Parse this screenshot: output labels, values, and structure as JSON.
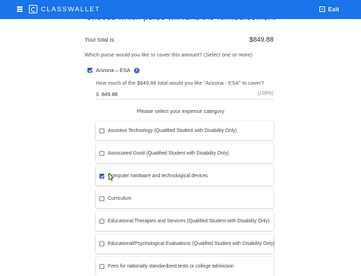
{
  "app": {
    "brand": "CLASSWALLET",
    "exit_label": "Exit"
  },
  "page": {
    "heading": "Choose which purse will fund the reimbursement",
    "total_label": "Your total is:",
    "total_value": "$849.88",
    "purse_question": "Which purse would you like to cover this amount? (Select one or more)"
  },
  "purse": {
    "label": "Arizona – ESA",
    "checked": true,
    "info_icon": "i",
    "amount_question": "How much of the $849.88 total would you like \"Arizona - ESA\" to cover?",
    "currency_symbol": "$",
    "amount_value": "849.88",
    "percent": "(100%)"
  },
  "categories": {
    "heading": "Please select your expense category",
    "items": [
      {
        "label": "Assistive Technology (Qualified Student with Disability Only)",
        "checked": false
      },
      {
        "label": "Associated Good (Qualified Student with Disability Only)",
        "checked": false
      },
      {
        "label": "Computer hardware and technological devices",
        "checked": true
      },
      {
        "label": "Curriculum",
        "checked": false
      },
      {
        "label": "Educational Therapies and Services (Qualified Student with Disability Only)",
        "checked": false
      },
      {
        "label": "Educational/Psychological Evaluations (Qualified Student with Disability Only)",
        "checked": false
      },
      {
        "label": "Fees for nationally standardized tests or college admission",
        "checked": false
      }
    ]
  },
  "colors": {
    "topbar": "#1a73e8",
    "checkbox_checked": "#3c5cc4",
    "info_icon": "#3c6fd8"
  },
  "icons": {
    "menu": "hamburger-menu-icon",
    "logo": "classwallet-logo-icon",
    "exit": "exit-icon",
    "info": "info-icon",
    "cursor": "mouse-pointer-icon"
  }
}
